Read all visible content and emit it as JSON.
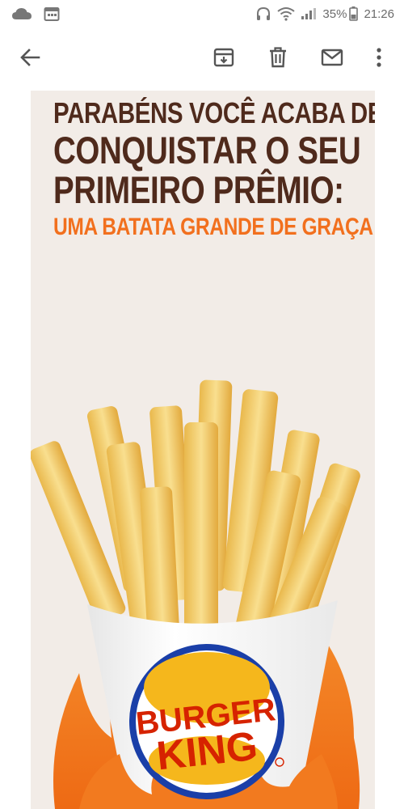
{
  "status_bar": {
    "battery": "35%",
    "time": "21:26"
  },
  "toolbar": {
    "back_icon": "arrow-left-icon",
    "archive_icon": "archive-icon",
    "delete_icon": "trash-icon",
    "mark_unread_icon": "mail-icon",
    "more_icon": "more-vertical-icon"
  },
  "email": {
    "headline_line1": "PARABÉNS VOCÊ ACABA DE",
    "headline_line2": "CONQUISTAR O SEU",
    "headline_line3": "PRIMEIRO PRÊMIO:",
    "headline_line4": "UMA BATATA GRANDE DE GRAÇA",
    "brand_logo_text": "BURGER KING"
  },
  "colors": {
    "headline": "#4f2a1c",
    "accent": "#f2701e",
    "background": "#f2ece7"
  }
}
